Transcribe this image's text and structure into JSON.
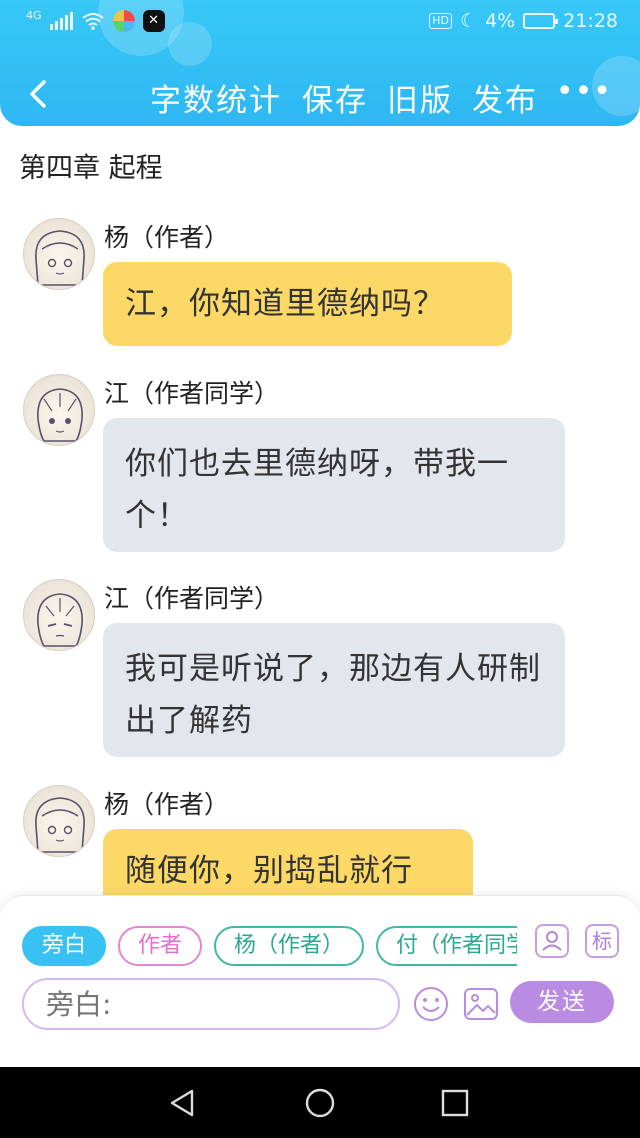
{
  "status_bar": {
    "network": "4G",
    "hd_badge": "HD",
    "battery": "4%",
    "time": "21:28"
  },
  "toolbar": {
    "word_count_label": "字数统计",
    "save_label": "保存",
    "old_version_label": "旧版",
    "publish_label": "发布",
    "more_label": "•••"
  },
  "chapter_title": "第四章 起程",
  "messages": [
    {
      "sender": "杨（作者）",
      "text": "江，你知道里德纳吗？",
      "style": "yellow"
    },
    {
      "sender": "江（作者同学）",
      "text": "你们也去里德纳呀，带我一个！",
      "style": "gray"
    },
    {
      "sender": "江（作者同学）",
      "text": "我可是听说了，那边有人研制出了解药",
      "style": "gray"
    },
    {
      "sender": "杨（作者）",
      "text": "随便你，别捣乱就行",
      "style": "yellow"
    }
  ],
  "composer": {
    "role_chips": [
      "旁白",
      "作者",
      "杨（作者）",
      "付（作者同学）"
    ],
    "tag_button": "标",
    "input_placeholder": "旁白:",
    "send_label": "发送"
  },
  "icons": {
    "back": "chevron-left-icon",
    "more": "more-icon",
    "role": "person-card-icon",
    "emoji": "smiley-icon",
    "image": "image-icon"
  },
  "colors": {
    "header": "#33c0f5",
    "author_bubble": "#fcd967",
    "other_bubble": "#e2e6ed",
    "send_button": "#b98be3"
  }
}
